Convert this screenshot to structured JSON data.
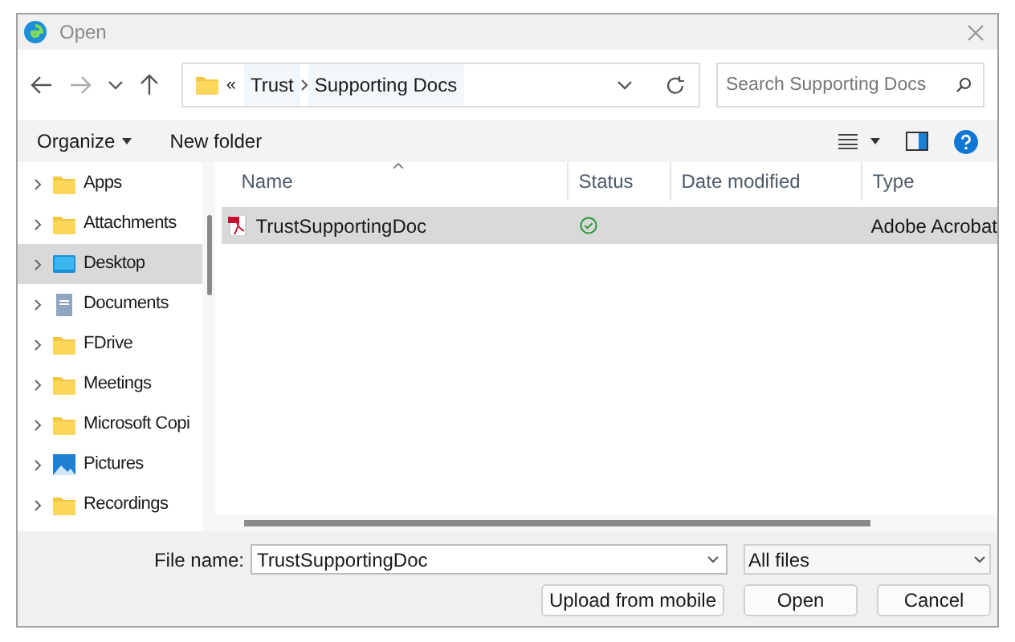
{
  "window": {
    "title": "Open"
  },
  "address": {
    "overflow": "«",
    "crumbs": [
      "Trust",
      "Supporting Docs"
    ]
  },
  "search": {
    "placeholder": "Search Supporting Docs"
  },
  "toolbar": {
    "organize": "Organize",
    "new_folder": "New folder"
  },
  "sidebar": {
    "items": [
      {
        "label": "Apps",
        "kind": "folder",
        "selected": false
      },
      {
        "label": "Attachments",
        "kind": "folder",
        "selected": false
      },
      {
        "label": "Desktop",
        "kind": "desktop",
        "selected": true
      },
      {
        "label": "Documents",
        "kind": "documents",
        "selected": false
      },
      {
        "label": "FDrive",
        "kind": "folder",
        "selected": false
      },
      {
        "label": "Meetings",
        "kind": "folder",
        "selected": false
      },
      {
        "label": "Microsoft Copi",
        "kind": "folder",
        "selected": false
      },
      {
        "label": "Pictures",
        "kind": "pictures",
        "selected": false
      },
      {
        "label": "Recordings",
        "kind": "folder",
        "selected": false
      }
    ]
  },
  "table": {
    "columns": [
      "Name",
      "Status",
      "Date modified",
      "Type"
    ],
    "rows": [
      {
        "name": "TrustSupportingDoc",
        "synced": true,
        "type": "Adobe Acrobat",
        "selected": true
      }
    ]
  },
  "footer": {
    "file_name_label": "File name:",
    "file_name": "TrustSupportingDoc",
    "filter": "All files",
    "buttons": [
      "Upload from mobile",
      "Open",
      "Cancel"
    ]
  }
}
